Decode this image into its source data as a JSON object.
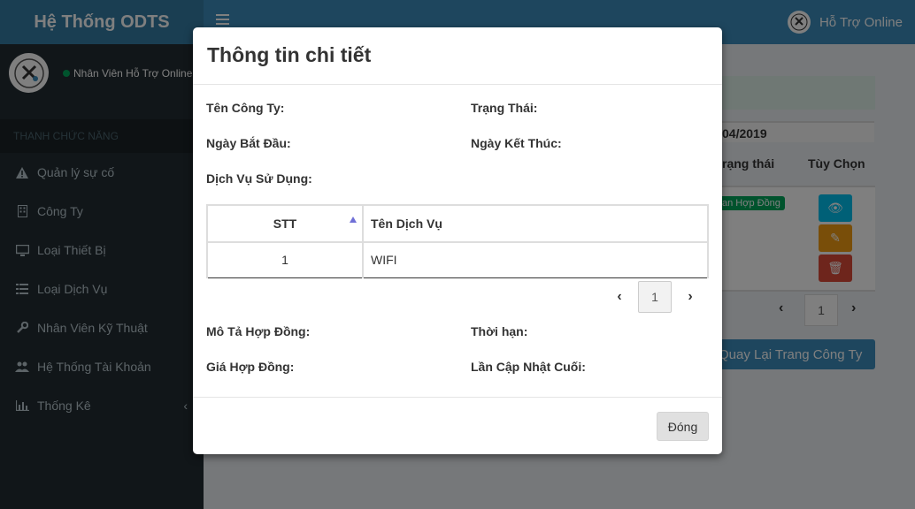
{
  "app": {
    "title": "Hệ Thống ODTS"
  },
  "topbar": {
    "user_label": "Hỗ Trợ Online",
    "avatar_text": "ODTS"
  },
  "sidebar": {
    "user_status": "Nhân Viên Hỗ Trợ Online",
    "avatar_text": "ODTS",
    "header": "THANH CHỨC NĂNG",
    "items": [
      {
        "label": "Quản lý sự cố",
        "icon": "warning-icon"
      },
      {
        "label": "Công Ty",
        "icon": "building-icon"
      },
      {
        "label": "Loại Thiết Bị",
        "icon": "desktop-icon"
      },
      {
        "label": "Loại Dịch Vụ",
        "icon": "list-icon"
      },
      {
        "label": "Nhân Viên Kỹ Thuật",
        "icon": "wrench-icon"
      },
      {
        "label": "Hệ Thống Tài Khoản",
        "icon": "users-icon"
      },
      {
        "label": "Thống Kê",
        "icon": "bar-chart-icon"
      }
    ]
  },
  "background": {
    "date_fragment": "04/2019",
    "col_status": "rạng thái",
    "col_options": "Tùy Chọn",
    "status_badge": "an Hợp Đồng",
    "page": "1",
    "back_button": "Quay Lại Trang Công Ty"
  },
  "modal": {
    "title": "Thông tin chi tiết",
    "fields": {
      "company": "Tên Công Ty:",
      "status": "Trạng Thái:",
      "start_date": "Ngày Bắt Đầu:",
      "end_date": "Ngày Kết Thúc:",
      "services": "Dịch Vụ Sử Dụng:",
      "description": "Mô Tả Hợp Đồng:",
      "duration": "Thời hạn:",
      "price": "Giá Hợp Đồng:",
      "last_update": "Lần Cập Nhật Cuối:"
    },
    "table": {
      "headers": [
        "STT",
        "Tên Dịch Vụ"
      ],
      "rows": [
        [
          "1",
          "WIFI"
        ]
      ]
    },
    "page": "1",
    "close_button": "Đóng"
  },
  "colors": {
    "topbar": "#3c8dbc",
    "logo_bar": "#357ca5",
    "sidebar": "#222d32",
    "success": "#00a65a",
    "info": "#00c0ef",
    "warning": "#f39c12",
    "danger": "#dd4b39"
  }
}
